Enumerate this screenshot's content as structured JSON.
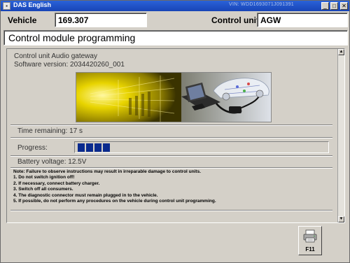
{
  "window": {
    "title": "DAS English",
    "vin_fragment": "VIN: WDD1693071J091391",
    "controls": [
      "minimize",
      "maximize",
      "close"
    ]
  },
  "vehicle": {
    "label": "Vehicle",
    "value": "169.307"
  },
  "control_unit": {
    "label": "Control unit",
    "value": "AGW"
  },
  "page_title": "Control module programming",
  "info": {
    "line1": "Control unit Audio gateway",
    "line2": "Software version: 2034420260_001"
  },
  "illustration": {
    "icon": "laptop-diagnostic-car-illustration"
  },
  "time_remaining": "Time remaining: 17 s",
  "progress": {
    "label": "Progress:",
    "filled_blocks": 4,
    "fraction": 0.08
  },
  "battery": "Battery voltage: 12.5V",
  "notes": [
    "Note: Failure to observe instructions may result in irreparable damage to control units.",
    "1. Do not switch ignition off!",
    "2. If necessary, connect battery charger.",
    "3. Switch off all consumers.",
    "4. The diagnostic connector must remain plugged in to the vehicle.",
    "5. If possible, do not perform any procedures on the vehicle during control unit programming."
  ],
  "f11_button": {
    "label": "F11",
    "icon": "printer-icon"
  },
  "colors": {
    "titlebar": "#1f50c8",
    "progress_fill": "#0a2a8e",
    "illustration_yellow": "#e8d400"
  }
}
